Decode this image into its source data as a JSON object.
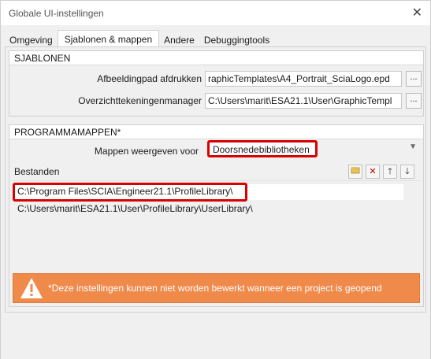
{
  "window": {
    "title": "Globale UI-instellingen",
    "close_glyph": "✕"
  },
  "tabs": [
    {
      "label": "Omgeving",
      "active": false
    },
    {
      "label": "Sjablonen & mappen",
      "active": true
    },
    {
      "label": "Andere",
      "active": false
    },
    {
      "label": "Debuggingtools",
      "active": false
    }
  ],
  "sjablonen": {
    "header": "SJABLONEN",
    "print_path_label": "Afbeeldingpad afdrukken",
    "print_path_value": "raphicTemplates\\A4_Portrait_SciaLogo.epd",
    "overview_label": "Overzichttekeningenmanager",
    "overview_value": "C:\\Users\\marit\\ESA21.1\\User\\GraphicTempl",
    "browse_label": "..."
  },
  "programmamappen": {
    "header": "PROGRAMMAMAPPEN*",
    "show_folders_label": "Mappen weergeven voor",
    "show_folders_value": "Doorsnedebibliotheken",
    "files_label": "Bestanden",
    "files": [
      "C:\\Program Files\\SCIA\\Engineer21.1\\ProfileLibrary\\",
      "C:\\Users\\marit\\ESA21.1\\User\\ProfileLibrary\\UserLibrary\\"
    ],
    "tool_icons": [
      "new-folder-icon",
      "delete-icon",
      "move-up-icon",
      "move-down-icon"
    ]
  },
  "warning": {
    "text": "*Deze instellingen kunnen niet worden bewerkt wanneer een project is geopend",
    "color": "#f08a4b"
  },
  "colors": {
    "highlight": "#d90000",
    "warning_bg": "#f08a4b"
  }
}
